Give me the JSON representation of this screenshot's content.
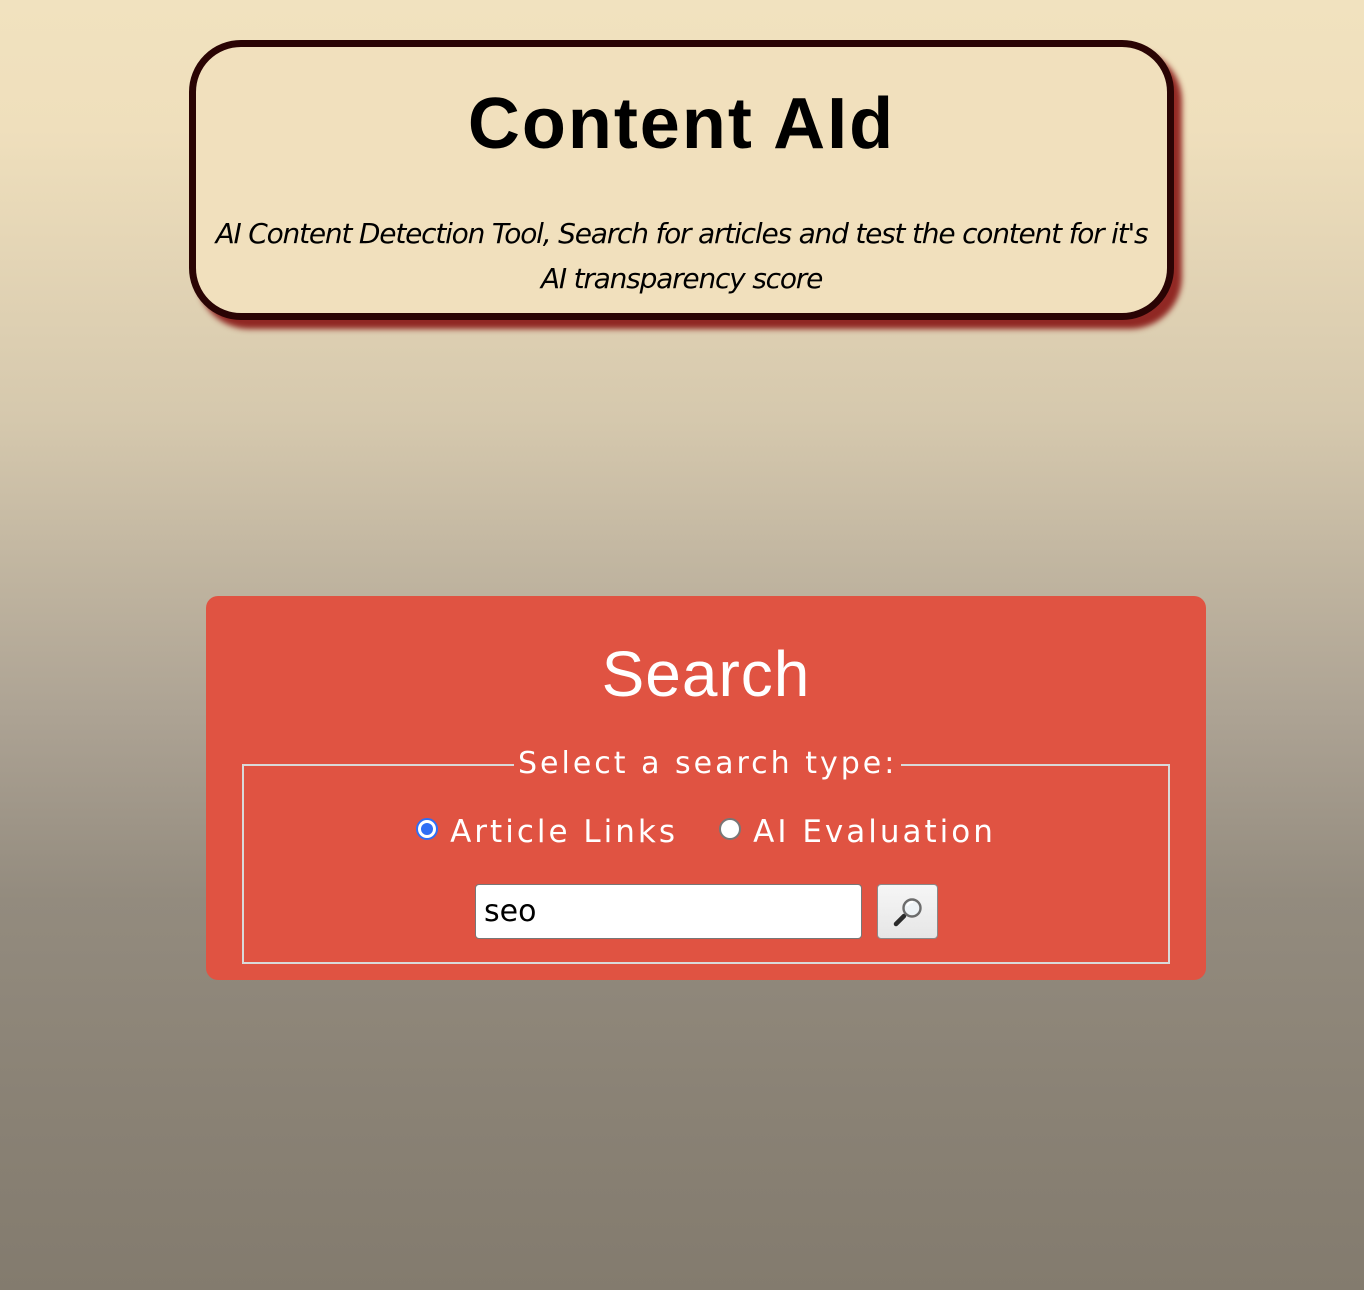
{
  "header": {
    "title": "Content AId",
    "subtitle": "AI Content Detection Tool, Search for articles and test the content for it's AI transparency score"
  },
  "search": {
    "title": "Search",
    "legend": "Select a search type:",
    "options": [
      {
        "label": "Article Links",
        "checked": true
      },
      {
        "label": "AI Evaluation",
        "checked": false
      }
    ],
    "query": "seo",
    "button_icon": "magnifying-glass-icon"
  },
  "colors": {
    "header_border": "#2a0404",
    "header_background": "#f1e0bd",
    "search_card": "#e05342",
    "radio_checked": "#2f6ef5"
  }
}
